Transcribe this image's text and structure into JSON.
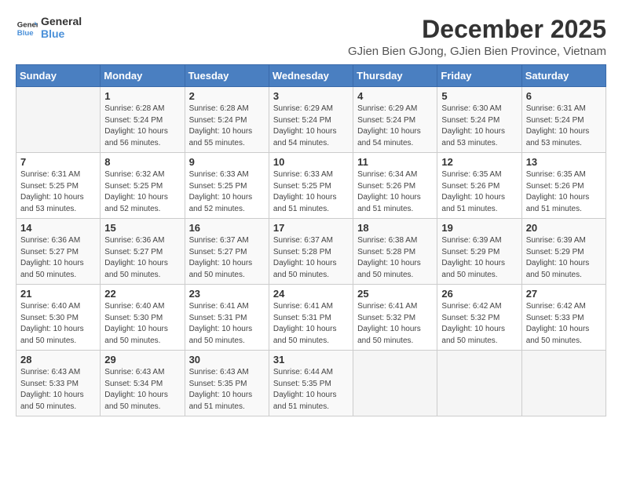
{
  "logo": {
    "general": "General",
    "blue": "Blue"
  },
  "header": {
    "title": "December 2025",
    "subtitle": "GJien Bien GJong, GJien Bien Province, Vietnam"
  },
  "weekdays": [
    "Sunday",
    "Monday",
    "Tuesday",
    "Wednesday",
    "Thursday",
    "Friday",
    "Saturday"
  ],
  "weeks": [
    [
      {
        "day": "",
        "info": ""
      },
      {
        "day": "1",
        "info": "Sunrise: 6:28 AM\nSunset: 5:24 PM\nDaylight: 10 hours\nand 56 minutes."
      },
      {
        "day": "2",
        "info": "Sunrise: 6:28 AM\nSunset: 5:24 PM\nDaylight: 10 hours\nand 55 minutes."
      },
      {
        "day": "3",
        "info": "Sunrise: 6:29 AM\nSunset: 5:24 PM\nDaylight: 10 hours\nand 54 minutes."
      },
      {
        "day": "4",
        "info": "Sunrise: 6:29 AM\nSunset: 5:24 PM\nDaylight: 10 hours\nand 54 minutes."
      },
      {
        "day": "5",
        "info": "Sunrise: 6:30 AM\nSunset: 5:24 PM\nDaylight: 10 hours\nand 53 minutes."
      },
      {
        "day": "6",
        "info": "Sunrise: 6:31 AM\nSunset: 5:24 PM\nDaylight: 10 hours\nand 53 minutes."
      }
    ],
    [
      {
        "day": "7",
        "info": "Sunrise: 6:31 AM\nSunset: 5:25 PM\nDaylight: 10 hours\nand 53 minutes."
      },
      {
        "day": "8",
        "info": "Sunrise: 6:32 AM\nSunset: 5:25 PM\nDaylight: 10 hours\nand 52 minutes."
      },
      {
        "day": "9",
        "info": "Sunrise: 6:33 AM\nSunset: 5:25 PM\nDaylight: 10 hours\nand 52 minutes."
      },
      {
        "day": "10",
        "info": "Sunrise: 6:33 AM\nSunset: 5:25 PM\nDaylight: 10 hours\nand 51 minutes."
      },
      {
        "day": "11",
        "info": "Sunrise: 6:34 AM\nSunset: 5:26 PM\nDaylight: 10 hours\nand 51 minutes."
      },
      {
        "day": "12",
        "info": "Sunrise: 6:35 AM\nSunset: 5:26 PM\nDaylight: 10 hours\nand 51 minutes."
      },
      {
        "day": "13",
        "info": "Sunrise: 6:35 AM\nSunset: 5:26 PM\nDaylight: 10 hours\nand 51 minutes."
      }
    ],
    [
      {
        "day": "14",
        "info": "Sunrise: 6:36 AM\nSunset: 5:27 PM\nDaylight: 10 hours\nand 50 minutes."
      },
      {
        "day": "15",
        "info": "Sunrise: 6:36 AM\nSunset: 5:27 PM\nDaylight: 10 hours\nand 50 minutes."
      },
      {
        "day": "16",
        "info": "Sunrise: 6:37 AM\nSunset: 5:27 PM\nDaylight: 10 hours\nand 50 minutes."
      },
      {
        "day": "17",
        "info": "Sunrise: 6:37 AM\nSunset: 5:28 PM\nDaylight: 10 hours\nand 50 minutes."
      },
      {
        "day": "18",
        "info": "Sunrise: 6:38 AM\nSunset: 5:28 PM\nDaylight: 10 hours\nand 50 minutes."
      },
      {
        "day": "19",
        "info": "Sunrise: 6:39 AM\nSunset: 5:29 PM\nDaylight: 10 hours\nand 50 minutes."
      },
      {
        "day": "20",
        "info": "Sunrise: 6:39 AM\nSunset: 5:29 PM\nDaylight: 10 hours\nand 50 minutes."
      }
    ],
    [
      {
        "day": "21",
        "info": "Sunrise: 6:40 AM\nSunset: 5:30 PM\nDaylight: 10 hours\nand 50 minutes."
      },
      {
        "day": "22",
        "info": "Sunrise: 6:40 AM\nSunset: 5:30 PM\nDaylight: 10 hours\nand 50 minutes."
      },
      {
        "day": "23",
        "info": "Sunrise: 6:41 AM\nSunset: 5:31 PM\nDaylight: 10 hours\nand 50 minutes."
      },
      {
        "day": "24",
        "info": "Sunrise: 6:41 AM\nSunset: 5:31 PM\nDaylight: 10 hours\nand 50 minutes."
      },
      {
        "day": "25",
        "info": "Sunrise: 6:41 AM\nSunset: 5:32 PM\nDaylight: 10 hours\nand 50 minutes."
      },
      {
        "day": "26",
        "info": "Sunrise: 6:42 AM\nSunset: 5:32 PM\nDaylight: 10 hours\nand 50 minutes."
      },
      {
        "day": "27",
        "info": "Sunrise: 6:42 AM\nSunset: 5:33 PM\nDaylight: 10 hours\nand 50 minutes."
      }
    ],
    [
      {
        "day": "28",
        "info": "Sunrise: 6:43 AM\nSunset: 5:33 PM\nDaylight: 10 hours\nand 50 minutes."
      },
      {
        "day": "29",
        "info": "Sunrise: 6:43 AM\nSunset: 5:34 PM\nDaylight: 10 hours\nand 50 minutes."
      },
      {
        "day": "30",
        "info": "Sunrise: 6:43 AM\nSunset: 5:35 PM\nDaylight: 10 hours\nand 51 minutes."
      },
      {
        "day": "31",
        "info": "Sunrise: 6:44 AM\nSunset: 5:35 PM\nDaylight: 10 hours\nand 51 minutes."
      },
      {
        "day": "",
        "info": ""
      },
      {
        "day": "",
        "info": ""
      },
      {
        "day": "",
        "info": ""
      }
    ]
  ]
}
